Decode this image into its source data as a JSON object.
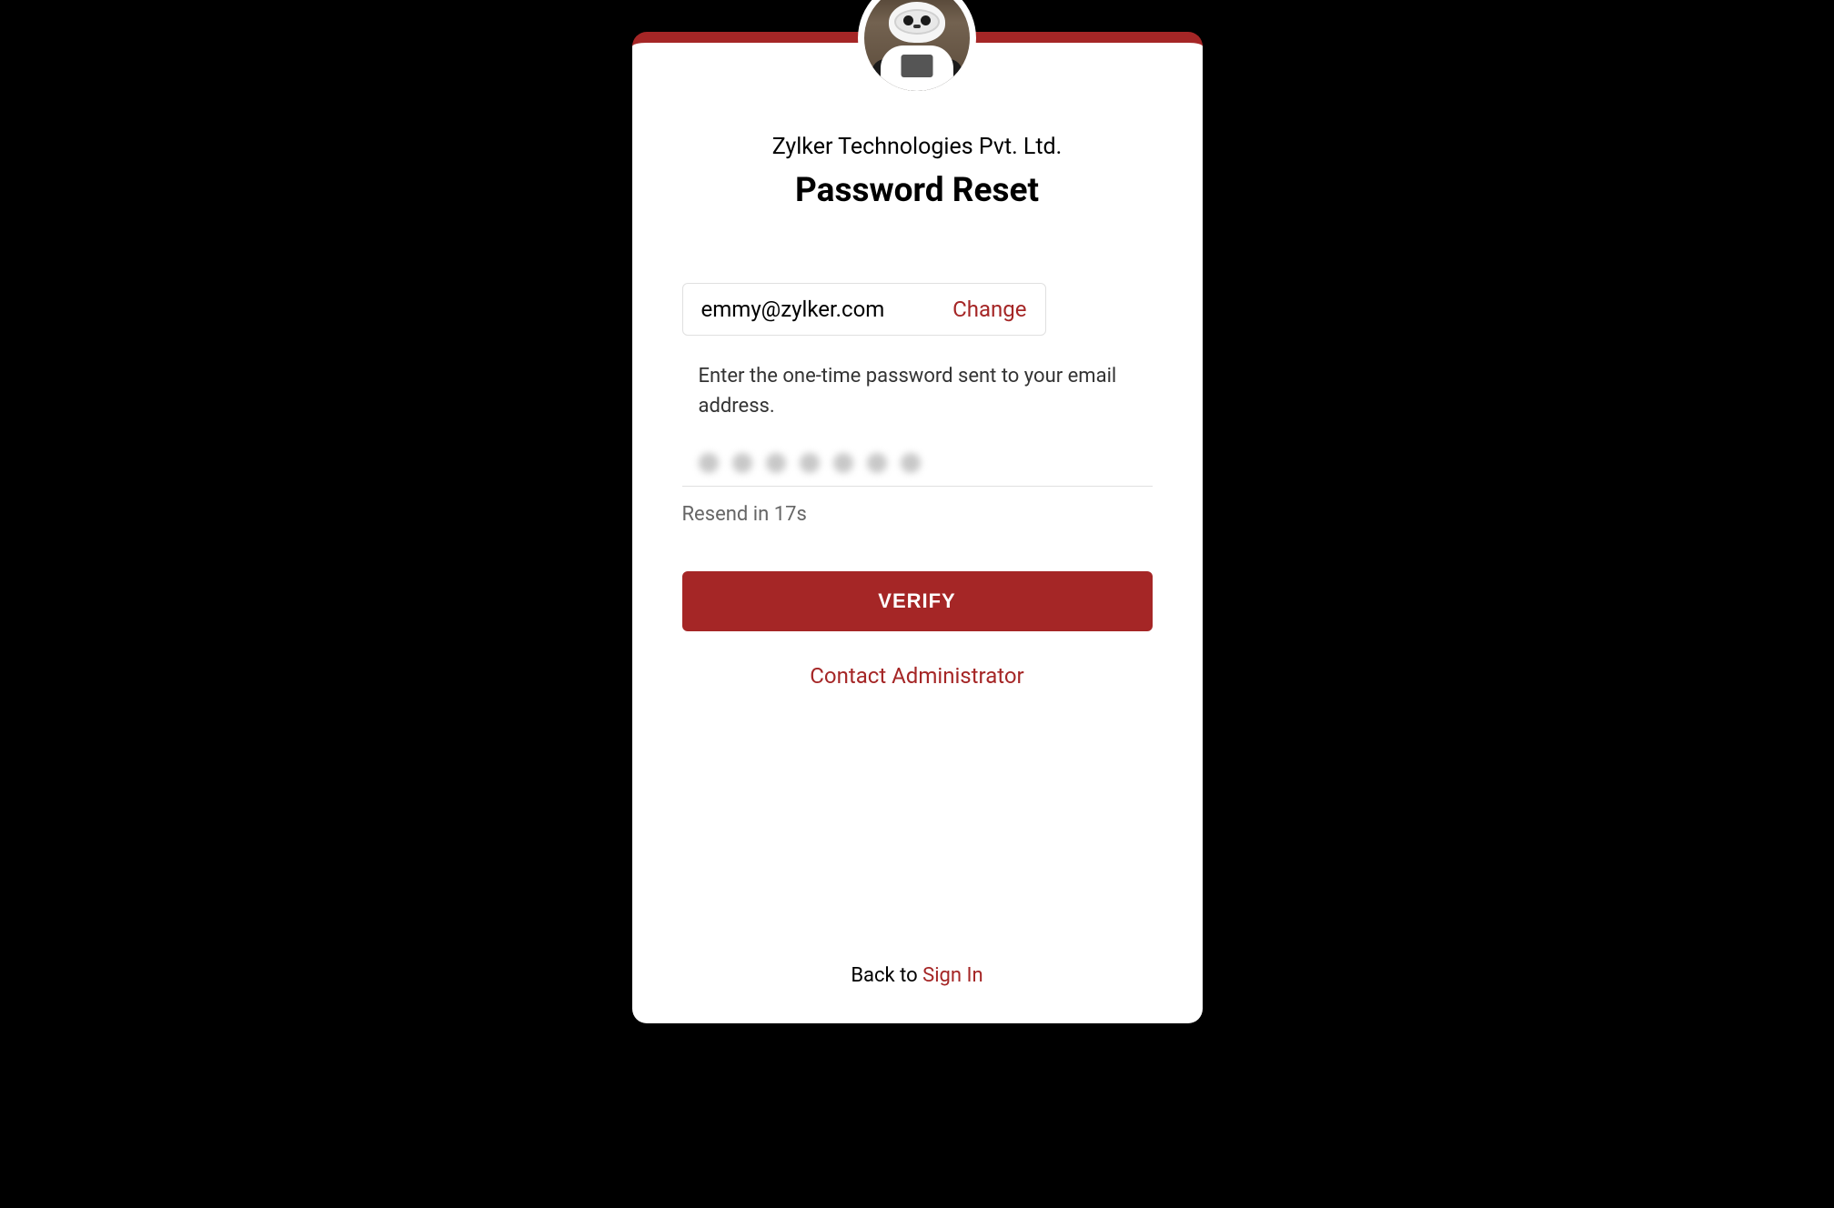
{
  "header": {
    "company_name": "Zylker Technologies Pvt. Ltd.",
    "page_title": "Password Reset"
  },
  "email_box": {
    "email": "emmy@zylker.com",
    "change_label": "Change"
  },
  "instruction": "Enter the one-time password sent to your email address.",
  "resend": {
    "prefix": "Resend in ",
    "seconds": "17",
    "suffix": "s"
  },
  "verify_button_label": "VERIFY",
  "contact_admin_label": "Contact Administrator",
  "footer": {
    "prefix": "Back to ",
    "sign_in_label": "Sign In"
  },
  "otp_digit_count": 7,
  "colors": {
    "accent": "#A52626"
  }
}
